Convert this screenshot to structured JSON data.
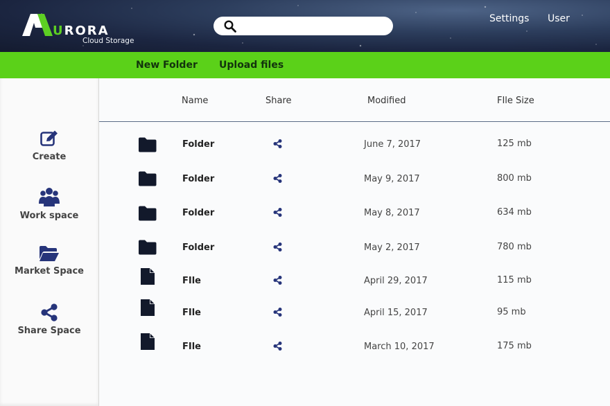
{
  "header": {
    "logo_letters_accent": "U",
    "logo_letters_rest": "RORA",
    "logo_subtitle": "Cloud Storage",
    "search": {
      "value": "",
      "placeholder": ""
    },
    "nav": {
      "settings": "Settings",
      "user": "User"
    }
  },
  "toolbar": {
    "new_folder": "New Folder",
    "upload_files": "Upload files"
  },
  "sidebar": {
    "items": [
      {
        "label": "Create",
        "icon": "edit-icon"
      },
      {
        "label": "Work space",
        "icon": "users-icon"
      },
      {
        "label": "Market Space",
        "icon": "folder-open-icon"
      },
      {
        "label": "Share Space",
        "icon": "share-icon"
      }
    ]
  },
  "table": {
    "columns": {
      "name": "Name",
      "share": "Share",
      "modified": "Modified",
      "size": "FIle Size"
    },
    "rows": [
      {
        "type": "folder",
        "name": "Folder",
        "modified": "June 7, 2017",
        "size": "125 mb"
      },
      {
        "type": "folder",
        "name": "Folder",
        "modified": "May 9, 2017",
        "size": "800 mb"
      },
      {
        "type": "folder",
        "name": "Folder",
        "modified": "May 8, 2017",
        "size": "634 mb"
      },
      {
        "type": "folder",
        "name": "Folder",
        "modified": "May 2, 2017",
        "size": "780 mb"
      },
      {
        "type": "file",
        "name": "FIle",
        "modified": "April 29, 2017",
        "size": "115 mb"
      },
      {
        "type": "file",
        "name": "FIle",
        "modified": "April 15, 2017",
        "size": "95 mb"
      },
      {
        "type": "file",
        "name": "FIle",
        "modified": "March 10, 2017",
        "size": "175 mb"
      }
    ]
  },
  "colors": {
    "accent_green": "#5bd119",
    "icon_navy": "#26347a",
    "folder_dark": "#12192b"
  }
}
